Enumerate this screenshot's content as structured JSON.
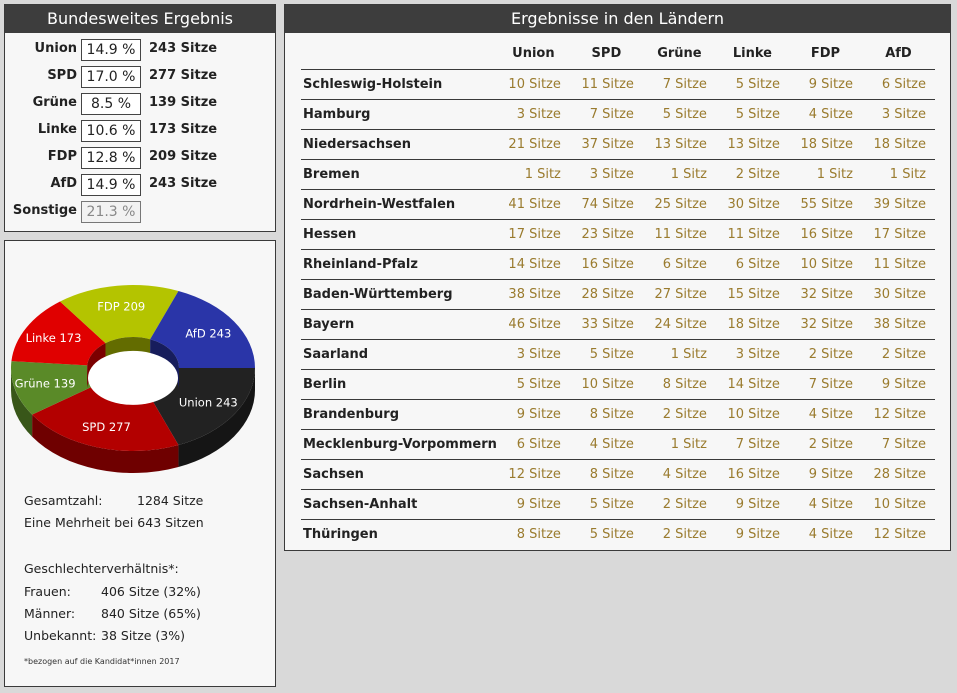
{
  "national": {
    "title": "Bundesweites Ergebnis",
    "rows": [
      {
        "party": "Union",
        "percent": "14.9 %",
        "seats": "243 Sitze"
      },
      {
        "party": "SPD",
        "percent": "17.0 %",
        "seats": "277 Sitze"
      },
      {
        "party": "Grüne",
        "percent": "8.5 %",
        "seats": "139 Sitze"
      },
      {
        "party": "Linke",
        "percent": "10.6 %",
        "seats": "173 Sitze"
      },
      {
        "party": "FDP",
        "percent": "12.8 %",
        "seats": "209 Sitze"
      },
      {
        "party": "AfD",
        "percent": "14.9 %",
        "seats": "243 Sitze"
      },
      {
        "party": "Sonstige",
        "percent": "21.3 %",
        "seats": ""
      }
    ]
  },
  "chart_data": {
    "type": "pie",
    "title": "",
    "categories": [
      "Union",
      "SPD",
      "Grüne",
      "Linke",
      "FDP",
      "AfD"
    ],
    "values": [
      243,
      277,
      139,
      173,
      209,
      243
    ],
    "labels": [
      "Union 243",
      "SPD 277",
      "Grüne 139",
      "Linke 173",
      "FDP 209",
      "AfD 243"
    ],
    "colors": [
      "#222222",
      "#b30000",
      "#5a8a28",
      "#e00000",
      "#b4c400",
      "#2a35a8"
    ],
    "donut": true
  },
  "summary": {
    "total_label": "Gesamtzahl:",
    "total_value": "1284 Sitze",
    "majority": "Eine Mehrheit bei 643 Sitzen",
    "gender_title": "Geschlechterverhältnis*:",
    "women_label": "Frauen:",
    "women_value": "406 Sitze (32%)",
    "men_label": "Männer:",
    "men_value": "840 Sitze (65%)",
    "unknown_label": "Unbekannt:",
    "unknown_value": "38 Sitze (3%)",
    "footnote": "*bezogen auf die Kandidat*innen 2017"
  },
  "states": {
    "title": "Ergebnisse in den Ländern",
    "columns": [
      "Union",
      "SPD",
      "Grüne",
      "Linke",
      "FDP",
      "AfD"
    ],
    "rows": [
      {
        "name": "Schleswig-Holstein",
        "values": [
          "10 Sitze",
          "11 Sitze",
          "7 Sitze",
          "5 Sitze",
          "9 Sitze",
          "6 Sitze"
        ]
      },
      {
        "name": "Hamburg",
        "values": [
          "3 Sitze",
          "7 Sitze",
          "5 Sitze",
          "5 Sitze",
          "4 Sitze",
          "3 Sitze"
        ]
      },
      {
        "name": "Niedersachsen",
        "values": [
          "21 Sitze",
          "37 Sitze",
          "13 Sitze",
          "13 Sitze",
          "18 Sitze",
          "18 Sitze"
        ]
      },
      {
        "name": "Bremen",
        "values": [
          "1 Sitz",
          "3 Sitze",
          "1 Sitz",
          "2 Sitze",
          "1 Sitz",
          "1 Sitz"
        ]
      },
      {
        "name": "Nordrhein-Westfalen",
        "values": [
          "41 Sitze",
          "74 Sitze",
          "25 Sitze",
          "30 Sitze",
          "55 Sitze",
          "39 Sitze"
        ]
      },
      {
        "name": "Hessen",
        "values": [
          "17 Sitze",
          "23 Sitze",
          "11 Sitze",
          "11 Sitze",
          "16 Sitze",
          "17 Sitze"
        ]
      },
      {
        "name": "Rheinland-Pfalz",
        "values": [
          "14 Sitze",
          "16 Sitze",
          "6 Sitze",
          "6 Sitze",
          "10 Sitze",
          "11 Sitze"
        ]
      },
      {
        "name": "Baden-Württemberg",
        "values": [
          "38 Sitze",
          "28 Sitze",
          "27 Sitze",
          "15 Sitze",
          "32 Sitze",
          "30 Sitze"
        ]
      },
      {
        "name": "Bayern",
        "values": [
          "46 Sitze",
          "33 Sitze",
          "24 Sitze",
          "18 Sitze",
          "32 Sitze",
          "38 Sitze"
        ]
      },
      {
        "name": "Saarland",
        "values": [
          "3 Sitze",
          "5 Sitze",
          "1 Sitz",
          "3 Sitze",
          "2 Sitze",
          "2 Sitze"
        ]
      },
      {
        "name": "Berlin",
        "values": [
          "5 Sitze",
          "10 Sitze",
          "8 Sitze",
          "14 Sitze",
          "7 Sitze",
          "9 Sitze"
        ]
      },
      {
        "name": "Brandenburg",
        "values": [
          "9 Sitze",
          "8 Sitze",
          "2 Sitze",
          "10 Sitze",
          "4 Sitze",
          "12 Sitze"
        ]
      },
      {
        "name": "Mecklenburg-Vorpommern",
        "values": [
          "6 Sitze",
          "4 Sitze",
          "1 Sitz",
          "7 Sitze",
          "2 Sitze",
          "7 Sitze"
        ]
      },
      {
        "name": "Sachsen",
        "values": [
          "12 Sitze",
          "8 Sitze",
          "4 Sitze",
          "16 Sitze",
          "9 Sitze",
          "28 Sitze"
        ]
      },
      {
        "name": "Sachsen-Anhalt",
        "values": [
          "9 Sitze",
          "5 Sitze",
          "2 Sitze",
          "9 Sitze",
          "4 Sitze",
          "10 Sitze"
        ]
      },
      {
        "name": "Thüringen",
        "values": [
          "8 Sitze",
          "5 Sitze",
          "2 Sitze",
          "9 Sitze",
          "4 Sitze",
          "12 Sitze"
        ]
      }
    ]
  }
}
